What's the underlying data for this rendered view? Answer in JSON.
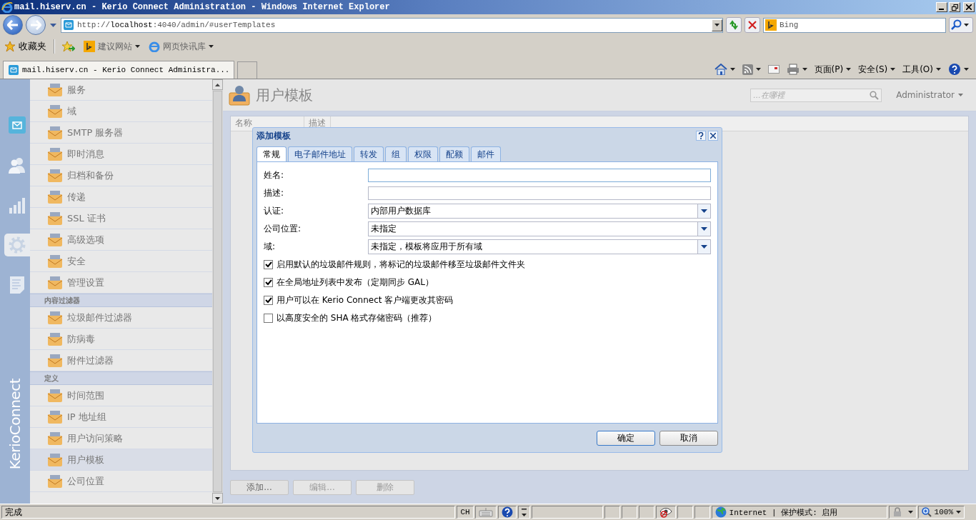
{
  "window": {
    "title": "mail.hiserv.cn - Kerio Connect Administration - Windows Internet Explorer"
  },
  "address_bar": {
    "url": "http://**localhost**:4040/admin/#userTemplates"
  },
  "search_box": {
    "placeholder": "Bing"
  },
  "favorites_bar": {
    "label": "收藏夹",
    "links": [
      "建议网站",
      "网页快讯库"
    ]
  },
  "tabs": [
    {
      "label": "mail.hiserv.cn - Kerio Connect Administra...",
      "selected": true
    }
  ],
  "command_bar": {
    "menus": [
      "页面(P)",
      "安全(S)",
      "工具(O)"
    ]
  },
  "app": {
    "rail": [
      {
        "kind": "mail",
        "selected": false
      },
      {
        "kind": "users",
        "selected": false
      },
      {
        "kind": "stats",
        "selected": false
      },
      {
        "kind": "settings",
        "selected": true
      },
      {
        "kind": "logs",
        "selected": false
      }
    ],
    "brand": "KerioConnect",
    "nav": {
      "groups": [
        {
          "items": [
            {
              "label": "服务",
              "selected": false
            },
            {
              "label": "域",
              "selected": false
            },
            {
              "label": "SMTP 服务器",
              "selected": false
            },
            {
              "label": "即时消息",
              "selected": false
            },
            {
              "label": "归档和备份",
              "selected": false
            },
            {
              "label": "传递",
              "selected": false
            },
            {
              "label": "SSL 证书",
              "selected": false
            },
            {
              "label": "高级选项",
              "selected": false
            },
            {
              "label": "安全",
              "selected": false
            },
            {
              "label": "管理设置",
              "selected": false
            }
          ]
        },
        {
          "heading": "内容过滤器",
          "items": [
            {
              "label": "垃圾邮件过滤器",
              "selected": false
            },
            {
              "label": "防病毒",
              "selected": false
            },
            {
              "label": "附件过滤器",
              "selected": false
            }
          ]
        },
        {
          "heading": "定义",
          "items": [
            {
              "label": "时间范围",
              "selected": false
            },
            {
              "label": "IP 地址组",
              "selected": false
            },
            {
              "label": "用户访问策略",
              "selected": false
            },
            {
              "label": "用户模板",
              "selected": true
            },
            {
              "label": "公司位置",
              "selected": false
            }
          ]
        }
      ]
    },
    "page_title": "用户模板",
    "search": {
      "placeholder": "...在哪裡"
    },
    "user_menu": "Administrator",
    "table": {
      "columns": [
        "名称",
        "描述"
      ]
    },
    "buttons": [
      {
        "label": "添加...",
        "disabled": false
      },
      {
        "label": "编辑...",
        "disabled": true
      },
      {
        "label": "删除",
        "disabled": true
      }
    ]
  },
  "dialog": {
    "title": "添加模板",
    "tabs": [
      {
        "label": "常规",
        "selected": true
      },
      {
        "label": "电子邮件地址",
        "selected": false
      },
      {
        "label": "转发",
        "selected": false
      },
      {
        "label": "组",
        "selected": false
      },
      {
        "label": "权限",
        "selected": false
      },
      {
        "label": "配额",
        "selected": false
      },
      {
        "label": "邮件",
        "selected": false
      }
    ],
    "fields": [
      {
        "label": "姓名:",
        "kind": "text",
        "focused": true
      },
      {
        "label": "描述:",
        "kind": "text",
        "focused": false
      },
      {
        "label": "认证:",
        "kind": "select",
        "value": "内部用户数据库"
      },
      {
        "label": "公司位置:",
        "kind": "select",
        "value": "未指定"
      },
      {
        "label": "域:",
        "kind": "select",
        "value": "未指定，模板将应用于所有域"
      }
    ],
    "checkboxes": [
      {
        "label": "启用默认的垃圾邮件规则，将标记的垃圾邮件移至垃圾邮件文件夹",
        "checked": true
      },
      {
        "label": "在全局地址列表中发布（定期同步 GAL）",
        "checked": true
      },
      {
        "label": "用户可以在 Kerio Connect 客户端更改其密码",
        "checked": true
      },
      {
        "label": "以高度安全的 SHA 格式存储密码（推荐）",
        "checked": false
      }
    ],
    "buttons": [
      {
        "label": "确定",
        "default": true
      },
      {
        "label": "取消",
        "default": false
      }
    ]
  },
  "status_bar": {
    "text": "完成",
    "language": "CH",
    "zone": "Internet | 保护模式: 启用",
    "zoom": "100%"
  }
}
